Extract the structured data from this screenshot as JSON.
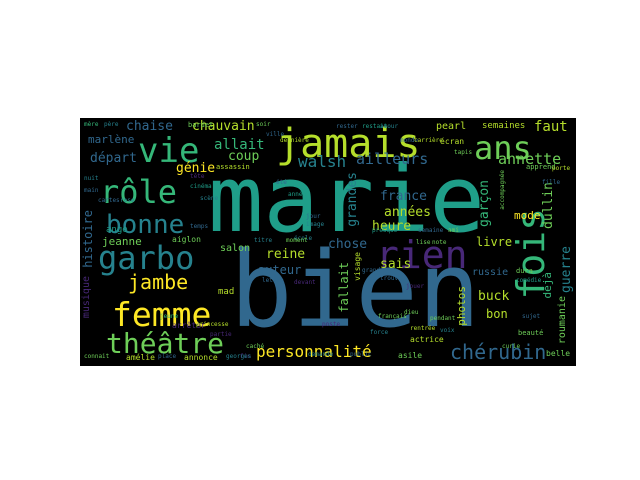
{
  "palette": {
    "yellow": "#fde725",
    "lime": "#b5de2b",
    "green": "#6ece58",
    "mint": "#35b779",
    "teal": "#1f9e89",
    "cyan": "#26828e",
    "blue": "#31688e",
    "indigo": "#3e4989",
    "purple": "#482878",
    "violet": "#440154"
  },
  "words": {
    "marie": "marie",
    "bien": "bien",
    "jamais": "jamais",
    "vie": "vie",
    "ans": "ans",
    "role": "rôle",
    "garbo": "garbo",
    "bonne": "bonne",
    "femme": "femme",
    "theatre": "théâtre",
    "fois": "fois",
    "rien": "rien",
    "jambe": "jambe",
    "personnalite": "personnalité",
    "cherubin": "chérubin",
    "chaise": "chaise",
    "chauvain": "chauvain",
    "marlene": "marlène",
    "depart": "départ",
    "allait": "allait",
    "coup": "coup",
    "genie": "génie",
    "walsh": "walsh",
    "ailleurs": "ailleurs",
    "annette": "annette",
    "faut": "faut",
    "semaines": "semaines",
    "pearl": "pearl",
    "ecran": "écran",
    "france": "france",
    "annees": "années",
    "heure": "heure",
    "sais": "sais",
    "garcon": "garçon",
    "dullin": "dullin",
    "guerre": "guerre",
    "deja": "déjà",
    "grandes": "grandes",
    "reine": "reine",
    "auteur": "auteur",
    "chose": "chose",
    "fallait": "fallait",
    "buck": "buck",
    "bon": "bon",
    "livre": "livre",
    "mode": "mode",
    "russie": "russie",
    "roumanie": "roumanie",
    "photos": "photos",
    "histoire": "histoire",
    "jeanne": "jeanne",
    "ange": "ange",
    "salon": "salon",
    "aiglon": "aiglon",
    "musique": "musique",
    "mad": "mad",
    "visage": "visage",
    "arreter": "arrêter",
    "annonce": "annonce",
    "amelie": "amélie",
    "belle": "belle",
    "asile": "asile",
    "actrice": "actrice",
    "dura": "dura",
    "bardet": "bardet",
    "assassin": "assassin",
    "place": "place",
    "jeune": "jeune",
    "francais": "français",
    "beaute": "beauté",
    "apprend": "apprend",
    "connait": "connait",
    "ete": "été",
    "lise": "lise",
    "note": "note",
    "porte": "porte",
    "poste": "poste",
    "mere": "mère",
    "pere": "père",
    "amour": "amour",
    "monde": "monde",
    "soir": "soir",
    "ville": "ville",
    "nuit": "nuit",
    "main": "main",
    "tete": "tête",
    "cinema": "cinéma",
    "scene": "scène",
    "temps": "temps",
    "jour": "jour",
    "image": "image",
    "annee": "année",
    "ecole": "école",
    "carriere": "carrière",
    "presque": "presque",
    "semaine": "semaine",
    "ami": "ami",
    "grand": "grand",
    "cache": "caché",
    "devant": "devant",
    "titre": "titre",
    "lettre": "lettre",
    "rentree": "rentrée",
    "demande": "demande",
    "public": "public",
    "princesse": "princesse",
    "fin": "fin",
    "force": "force",
    "dieu": "dieu",
    "cartes": "cartes",
    "rose": "rose",
    "fille": "fille",
    "accompagnee": "accompagnée",
    "comedie": "comédie",
    "trouve": "trouve",
    "jouer": "jouer",
    "pendant": "pendant",
    "voix": "voix",
    "moment": "moment",
    "derniere": "dernière",
    "curie": "curie",
    "sujet": "sujet",
    "tapis": "tapis",
    "partie": "partie",
    "georges": "georges",
    "rester": "rester",
    "restait": "restait"
  }
}
